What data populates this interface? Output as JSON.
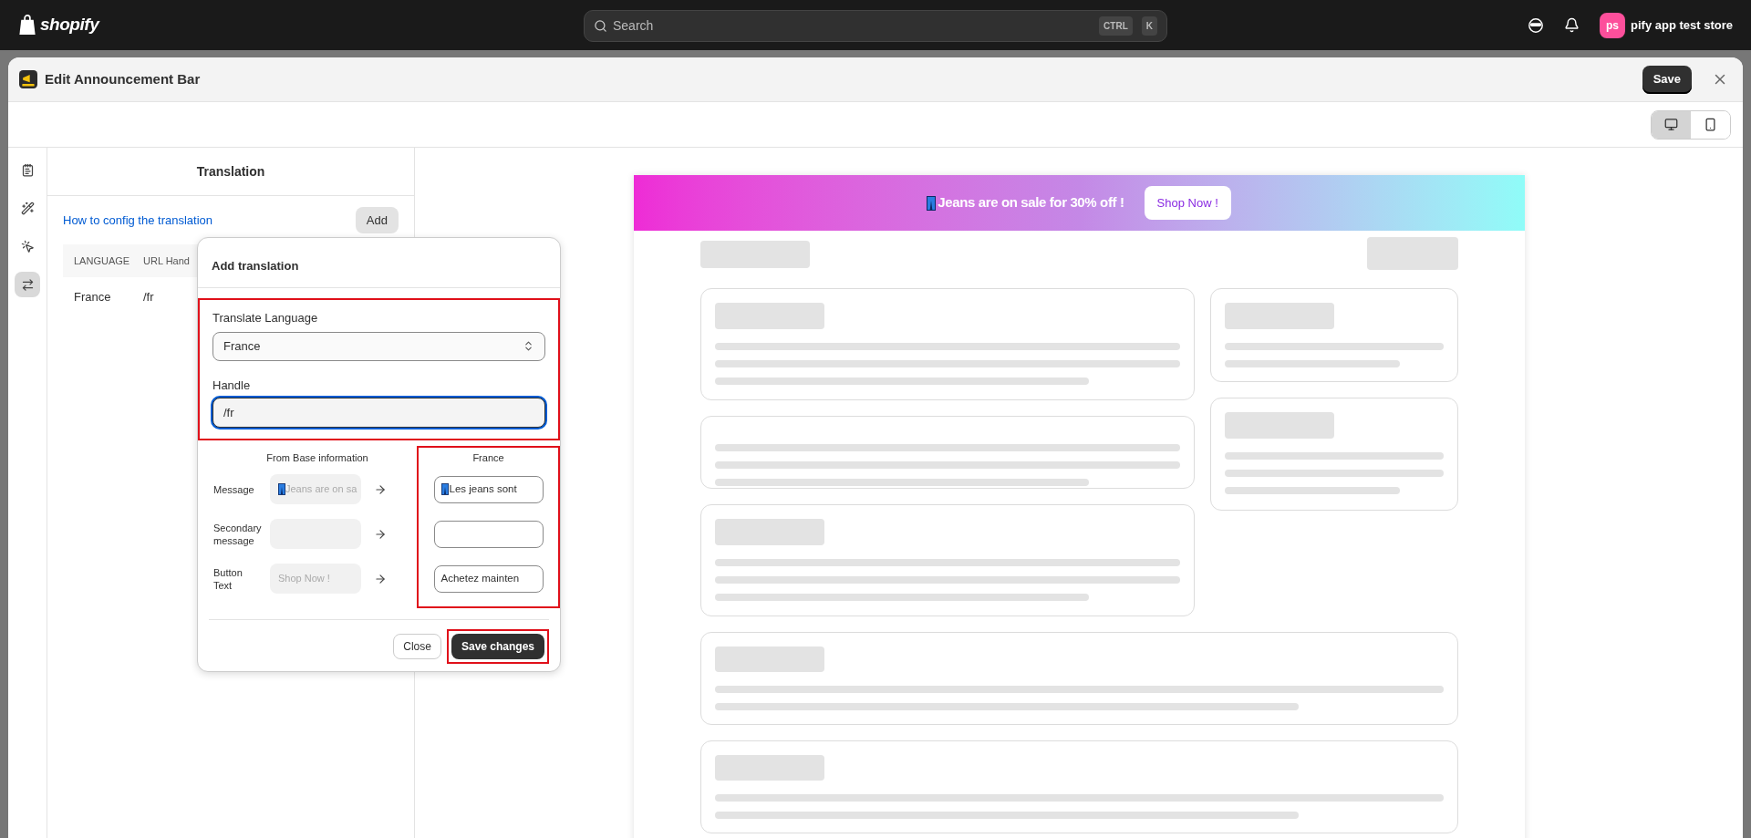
{
  "top_bar": {
    "logo_text": "shopify",
    "search": {
      "placeholder": "Search",
      "shortcut_keys": [
        "CTRL",
        "K"
      ]
    },
    "store": {
      "avatar_initials": "ps",
      "name": "pify app test store"
    }
  },
  "window": {
    "title": "Edit Announcement Bar",
    "save_button": "Save"
  },
  "device_toggle": [
    {
      "kind": "desktop",
      "selected": true
    },
    {
      "kind": "mobile",
      "selected": false
    }
  ],
  "sidebar_rail": [
    {
      "kind": "content",
      "selected": false
    },
    {
      "kind": "design",
      "selected": false
    },
    {
      "kind": "targeting",
      "selected": false
    },
    {
      "kind": "translation",
      "selected": true
    }
  ],
  "translation_panel": {
    "title": "Translation",
    "help_link": "How to config the translation",
    "add_button": "Add",
    "table": {
      "columns": [
        "LANGUAGE",
        "URL Hand"
      ],
      "rows": [
        {
          "language": "France",
          "url_handle": "/fr"
        }
      ]
    }
  },
  "dialog": {
    "title": "Add translation",
    "language_section": {
      "highlighted": true,
      "language_label": "Translate Language",
      "language_value": "France",
      "handle_label": "Handle",
      "handle_value": "/fr",
      "handle_focused": true
    },
    "fields": {
      "base_header": "From Base information",
      "target_header": "France",
      "target_highlighted": true,
      "rows": [
        {
          "label": "Message",
          "base_value": "Jeans are on sa",
          "base_emoji": true,
          "target_value": "Les jeans sont",
          "target_emoji": true
        },
        {
          "label": "Secondary message",
          "base_emoji": false,
          "target_emoji": false
        },
        {
          "label": "Button Text",
          "base_value": "Shop Now !",
          "base_emoji": false,
          "target_value": "Achetez mainten",
          "target_emoji": false
        }
      ]
    },
    "close_button": "Close",
    "save_button": "Save changes",
    "save_highlighted": true
  },
  "preview": {
    "banner": {
      "message": "Jeans are on sale for 30% off !",
      "button": "Shop Now !"
    }
  }
}
